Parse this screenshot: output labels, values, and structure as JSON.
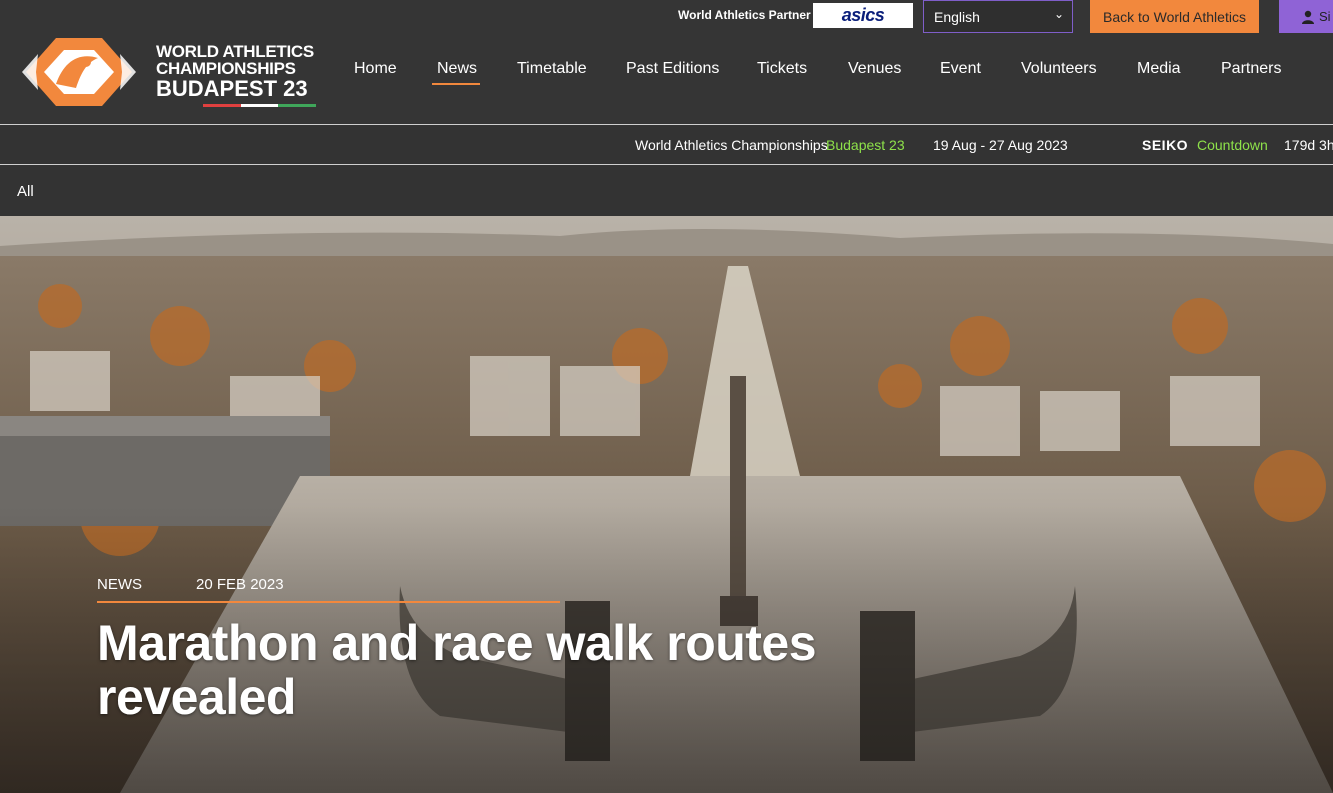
{
  "topbar": {
    "partner_label": "World Athletics Partner",
    "partner_logo": "asics",
    "language_selected": "English",
    "back_button": "Back to World Athletics",
    "signin_label": "Si"
  },
  "logo": {
    "line1": "WORLD ATHLETICS",
    "line2": "CHAMPIONSHIPS",
    "line3": "BUDAPEST 23"
  },
  "nav": {
    "items": [
      "Home",
      "News",
      "Timetable",
      "Past Editions",
      "Tickets",
      "Venues",
      "Event",
      "Volunteers",
      "Media",
      "Partners"
    ],
    "active": "News"
  },
  "ticker": {
    "event_name": "World Athletics Championships",
    "event_city": "Budapest 23",
    "dates": "19 Aug - 27 Aug 2023",
    "sponsor": "SEIKO",
    "countdown_label": "Countdown",
    "countdown_value": "179d 3h"
  },
  "filter": {
    "label": "All"
  },
  "hero": {
    "category": "NEWS",
    "date": "20 FEB 2023",
    "headline": "Marathon and race walk routes revealed"
  },
  "colors": {
    "accent_orange": "#f2883d",
    "accent_purple": "#8f63d6",
    "accent_green": "#8ee24a",
    "header_bg": "#353535"
  }
}
